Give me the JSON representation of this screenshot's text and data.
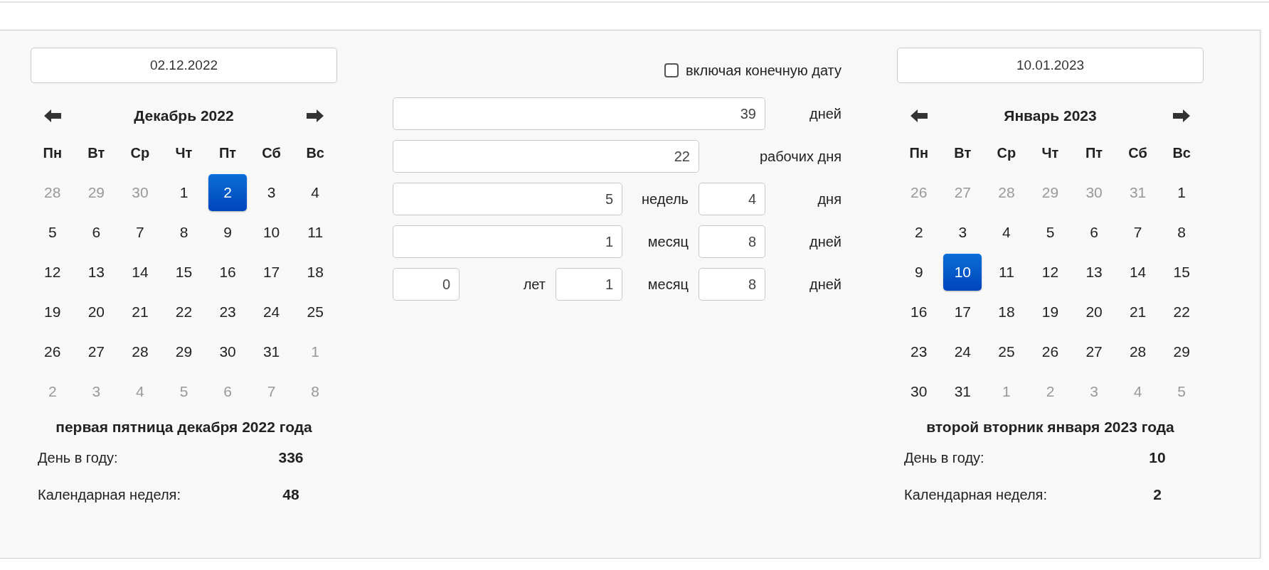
{
  "start": {
    "date": "02.12.2022",
    "calendar": {
      "title": "Декабрь 2022",
      "weekdays": [
        "Пн",
        "Вт",
        "Ср",
        "Чт",
        "Пт",
        "Сб",
        "Вс"
      ],
      "days": [
        {
          "day": "28",
          "outside": true,
          "selected": false
        },
        {
          "day": "29",
          "outside": true,
          "selected": false
        },
        {
          "day": "30",
          "outside": true,
          "selected": false
        },
        {
          "day": "1",
          "outside": false,
          "selected": false
        },
        {
          "day": "2",
          "outside": false,
          "selected": true
        },
        {
          "day": "3",
          "outside": false,
          "selected": false
        },
        {
          "day": "4",
          "outside": false,
          "selected": false
        },
        {
          "day": "5",
          "outside": false,
          "selected": false
        },
        {
          "day": "6",
          "outside": false,
          "selected": false
        },
        {
          "day": "7",
          "outside": false,
          "selected": false
        },
        {
          "day": "8",
          "outside": false,
          "selected": false
        },
        {
          "day": "9",
          "outside": false,
          "selected": false
        },
        {
          "day": "10",
          "outside": false,
          "selected": false
        },
        {
          "day": "11",
          "outside": false,
          "selected": false
        },
        {
          "day": "12",
          "outside": false,
          "selected": false
        },
        {
          "day": "13",
          "outside": false,
          "selected": false
        },
        {
          "day": "14",
          "outside": false,
          "selected": false
        },
        {
          "day": "15",
          "outside": false,
          "selected": false
        },
        {
          "day": "16",
          "outside": false,
          "selected": false
        },
        {
          "day": "17",
          "outside": false,
          "selected": false
        },
        {
          "day": "18",
          "outside": false,
          "selected": false
        },
        {
          "day": "19",
          "outside": false,
          "selected": false
        },
        {
          "day": "20",
          "outside": false,
          "selected": false
        },
        {
          "day": "21",
          "outside": false,
          "selected": false
        },
        {
          "day": "22",
          "outside": false,
          "selected": false
        },
        {
          "day": "23",
          "outside": false,
          "selected": false
        },
        {
          "day": "24",
          "outside": false,
          "selected": false
        },
        {
          "day": "25",
          "outside": false,
          "selected": false
        },
        {
          "day": "26",
          "outside": false,
          "selected": false
        },
        {
          "day": "27",
          "outside": false,
          "selected": false
        },
        {
          "day": "28",
          "outside": false,
          "selected": false
        },
        {
          "day": "29",
          "outside": false,
          "selected": false
        },
        {
          "day": "30",
          "outside": false,
          "selected": false
        },
        {
          "day": "31",
          "outside": false,
          "selected": false
        },
        {
          "day": "1",
          "outside": true,
          "selected": false
        },
        {
          "day": "2",
          "outside": true,
          "selected": false
        },
        {
          "day": "3",
          "outside": true,
          "selected": false
        },
        {
          "day": "4",
          "outside": true,
          "selected": false
        },
        {
          "day": "5",
          "outside": true,
          "selected": false
        },
        {
          "day": "6",
          "outside": true,
          "selected": false
        },
        {
          "day": "7",
          "outside": true,
          "selected": false
        },
        {
          "day": "8",
          "outside": true,
          "selected": false
        }
      ]
    },
    "description": "первая пятница декабря 2022 года",
    "stats": [
      {
        "label": "День в году:",
        "value": "336"
      },
      {
        "label": "Календарная неделя:",
        "value": "48"
      }
    ]
  },
  "middle": {
    "include_end": {
      "label": "включая конечную дату",
      "checked": false
    },
    "rows": [
      {
        "items": [
          {
            "kind": "field",
            "value": "39"
          },
          {
            "kind": "label",
            "text": "дней"
          }
        ]
      },
      {
        "items": [
          {
            "kind": "field",
            "value": "22"
          },
          {
            "kind": "label",
            "text": "рабочих дня"
          }
        ]
      },
      {
        "items": [
          {
            "kind": "field",
            "value": "5"
          },
          {
            "kind": "label",
            "text": "недель"
          },
          {
            "kind": "field",
            "value": "4"
          },
          {
            "kind": "label",
            "text": "дня"
          }
        ]
      },
      {
        "items": [
          {
            "kind": "field",
            "value": "1"
          },
          {
            "kind": "label",
            "text": "месяц"
          },
          {
            "kind": "field",
            "value": "8"
          },
          {
            "kind": "label",
            "text": "дней"
          }
        ]
      },
      {
        "items": [
          {
            "kind": "field",
            "value": "0"
          },
          {
            "kind": "label",
            "text": "лет"
          },
          {
            "kind": "field",
            "value": "1"
          },
          {
            "kind": "label",
            "text": "месяц"
          },
          {
            "kind": "field",
            "value": "8"
          },
          {
            "kind": "label",
            "text": "дней"
          }
        ]
      }
    ]
  },
  "end": {
    "date": "10.01.2023",
    "calendar": {
      "title": "Январь 2023",
      "weekdays": [
        "Пн",
        "Вт",
        "Ср",
        "Чт",
        "Пт",
        "Сб",
        "Вс"
      ],
      "days": [
        {
          "day": "26",
          "outside": true,
          "selected": false
        },
        {
          "day": "27",
          "outside": true,
          "selected": false
        },
        {
          "day": "28",
          "outside": true,
          "selected": false
        },
        {
          "day": "29",
          "outside": true,
          "selected": false
        },
        {
          "day": "30",
          "outside": true,
          "selected": false
        },
        {
          "day": "31",
          "outside": true,
          "selected": false
        },
        {
          "day": "1",
          "outside": false,
          "selected": false
        },
        {
          "day": "2",
          "outside": false,
          "selected": false
        },
        {
          "day": "3",
          "outside": false,
          "selected": false
        },
        {
          "day": "4",
          "outside": false,
          "selected": false
        },
        {
          "day": "5",
          "outside": false,
          "selected": false
        },
        {
          "day": "6",
          "outside": false,
          "selected": false
        },
        {
          "day": "7",
          "outside": false,
          "selected": false
        },
        {
          "day": "8",
          "outside": false,
          "selected": false
        },
        {
          "day": "9",
          "outside": false,
          "selected": false
        },
        {
          "day": "10",
          "outside": false,
          "selected": true
        },
        {
          "day": "11",
          "outside": false,
          "selected": false
        },
        {
          "day": "12",
          "outside": false,
          "selected": false
        },
        {
          "day": "13",
          "outside": false,
          "selected": false
        },
        {
          "day": "14",
          "outside": false,
          "selected": false
        },
        {
          "day": "15",
          "outside": false,
          "selected": false
        },
        {
          "day": "16",
          "outside": false,
          "selected": false
        },
        {
          "day": "17",
          "outside": false,
          "selected": false
        },
        {
          "day": "18",
          "outside": false,
          "selected": false
        },
        {
          "day": "19",
          "outside": false,
          "selected": false
        },
        {
          "day": "20",
          "outside": false,
          "selected": false
        },
        {
          "day": "21",
          "outside": false,
          "selected": false
        },
        {
          "day": "22",
          "outside": false,
          "selected": false
        },
        {
          "day": "23",
          "outside": false,
          "selected": false
        },
        {
          "day": "24",
          "outside": false,
          "selected": false
        },
        {
          "day": "25",
          "outside": false,
          "selected": false
        },
        {
          "day": "26",
          "outside": false,
          "selected": false
        },
        {
          "day": "27",
          "outside": false,
          "selected": false
        },
        {
          "day": "28",
          "outside": false,
          "selected": false
        },
        {
          "day": "29",
          "outside": false,
          "selected": false
        },
        {
          "day": "30",
          "outside": false,
          "selected": false
        },
        {
          "day": "31",
          "outside": false,
          "selected": false
        },
        {
          "day": "1",
          "outside": true,
          "selected": false
        },
        {
          "day": "2",
          "outside": true,
          "selected": false
        },
        {
          "day": "3",
          "outside": true,
          "selected": false
        },
        {
          "day": "4",
          "outside": true,
          "selected": false
        },
        {
          "day": "5",
          "outside": true,
          "selected": false
        }
      ]
    },
    "description": "второй вторник января 2023 года",
    "stats": [
      {
        "label": "День в году:",
        "value": "10"
      },
      {
        "label": "Календарная неделя:",
        "value": "2"
      }
    ]
  }
}
